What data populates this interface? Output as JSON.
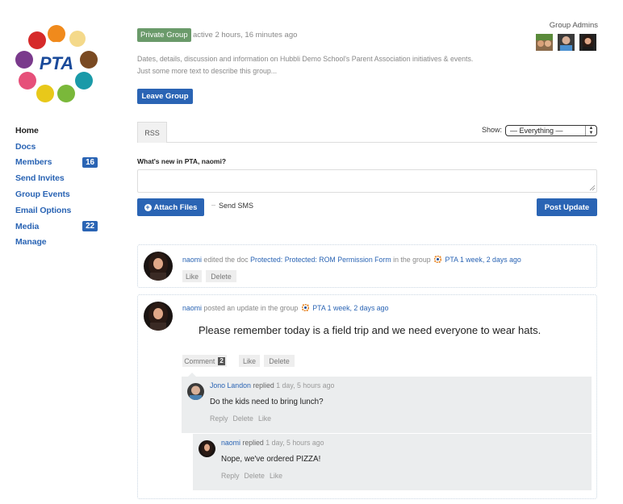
{
  "group": {
    "name": "PTA",
    "logo_text": "PTA",
    "privacy_badge": "Private Group",
    "active_time": "active 2 hours, 16 minutes ago",
    "description_line1": "Dates, details, discussion and information on Hubbli Demo School's Parent Association initiatives & events.",
    "description_line2": "Just some more text to describe this group...",
    "leave_button": "Leave Group",
    "admins_title": "Group Admins"
  },
  "sidebar": {
    "items": [
      {
        "label": "Home",
        "active": true
      },
      {
        "label": "Docs"
      },
      {
        "label": "Members",
        "badge": "16"
      },
      {
        "label": "Send Invites"
      },
      {
        "label": "Group Events"
      },
      {
        "label": "Email Options"
      },
      {
        "label": "Media",
        "badge": "22"
      },
      {
        "label": "Manage"
      }
    ]
  },
  "tabs": {
    "rss": "RSS",
    "show_label": "Show:",
    "show_selected": "— Everything —"
  },
  "post_form": {
    "prompt": "What's new in PTA, naomi?",
    "textarea_value": "",
    "attach_button": "Attach Files",
    "send_sms_label": "Send SMS",
    "post_button": "Post Update"
  },
  "activities": [
    {
      "author": "naomi",
      "action": "edited the doc",
      "doc_title": "Protected: Protected: ROM Permission Form",
      "in_group": "in the group",
      "group": "PTA",
      "time": "1 week, 2 days ago",
      "buttons": {
        "like": "Like",
        "delete": "Delete"
      }
    },
    {
      "author": "naomi",
      "action": "posted an update in the group",
      "group": "PTA",
      "time": "1 week, 2 days ago",
      "content": "Please remember today is a field trip and we need everyone to wear hats.",
      "buttons": {
        "comment": "Comment",
        "comment_count": "2",
        "like": "Like",
        "delete": "Delete"
      },
      "replies": [
        {
          "author": "Jono Landon",
          "verb": "replied",
          "time": "1 day, 5 hours ago",
          "text": "Do the kids need to bring lunch?",
          "actions": {
            "reply": "Reply",
            "delete": "Delete",
            "like": "Like"
          }
        },
        {
          "author": "naomi",
          "verb": "replied",
          "time": "1 day, 5 hours ago",
          "text": "Nope, we've ordered PIZZA!",
          "actions": {
            "reply": "Reply",
            "delete": "Delete",
            "like": "Like"
          }
        }
      ]
    }
  ],
  "colors": {
    "brand_blue": "#2a64b4",
    "private_badge": "#6a9a6a",
    "reply_bg": "#ebedee"
  }
}
